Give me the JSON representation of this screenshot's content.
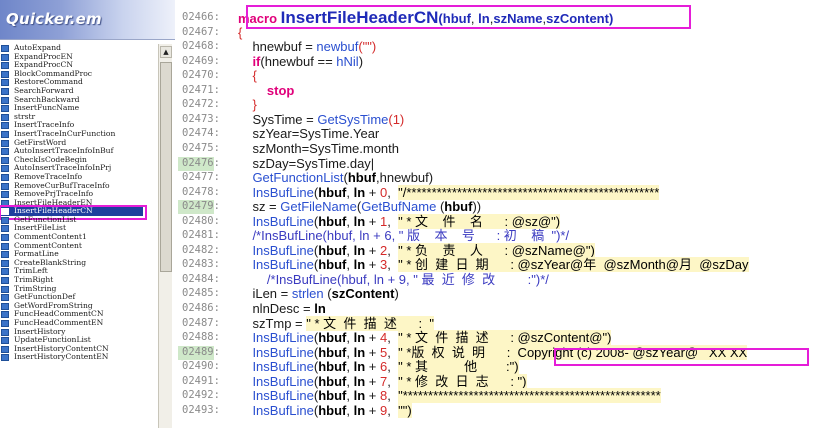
{
  "panel": {
    "title": "Quicker.em",
    "functions": [
      "AutoExpand",
      "ExpandProcEN",
      "ExpandProcCN",
      "BlockCommandProc",
      "RestoreCommand",
      "SearchForward",
      "SearchBackward",
      "InsertFuncName",
      "strstr",
      "InsertTraceInfo",
      "InsertTraceInCurFunction",
      "GetFirstWord",
      "AutoInsertTraceInfoInBuf",
      "CheckIsCodeBegin",
      "AutoInsertTraceInfoInPrj",
      "RemoveTraceInfo",
      "RemoveCurBufTraceInfo",
      "RemovePrjTraceInfo",
      "InsertFileHeaderEN",
      "InsertFileHeaderCN",
      "GetFunctionList",
      "InsertFileList",
      "CommentContent1",
      "CommentContent",
      "FormatLine",
      "CreateBlankString",
      "TrimLeft",
      "TrimRight",
      "TrimString",
      "GetFunctionDef",
      "GetWordFromString",
      "FuncHeadCommentCN",
      "FuncHeadCommentEN",
      "InsertHistory",
      "UpdateFunctionList",
      "InsertHistoryContentCN",
      "InsertHistoryContentEN"
    ],
    "selected_function": "InsertFileHeaderCN",
    "scroll_up_glyph": "▲"
  },
  "code": {
    "lines": [
      {
        "num": "02466:",
        "tokens": [
          [
            "kw",
            "macro "
          ],
          [
            "macro-name",
            "InsertFileHeaderCN"
          ],
          [
            "fnb",
            "("
          ],
          [
            "fnb",
            "hbuf"
          ],
          [
            "id",
            ", "
          ],
          [
            "fnb",
            "ln"
          ],
          [
            "id",
            ","
          ],
          [
            "fnb",
            "szName"
          ],
          [
            "id",
            ","
          ],
          [
            "fnb",
            "szContent"
          ],
          [
            "fnb",
            ")"
          ]
        ]
      },
      {
        "num": "02467:",
        "tokens": [
          [
            "num",
            "{"
          ]
        ]
      },
      {
        "num": "02468:",
        "tokens": [
          [
            "id",
            "    hnewbuf = "
          ],
          [
            "fn",
            "newbuf"
          ],
          [
            "num",
            "(\"\")"
          ]
        ]
      },
      {
        "num": "02469:",
        "tokens": [
          [
            "kw",
            "    if"
          ],
          [
            "id",
            "(hnewbuf == "
          ],
          [
            "fn",
            "hNil"
          ],
          [
            "id",
            ")"
          ]
        ]
      },
      {
        "num": "02470:",
        "tokens": [
          [
            "num",
            "    {"
          ]
        ]
      },
      {
        "num": "02471:",
        "tokens": [
          [
            "kw",
            "        stop"
          ]
        ]
      },
      {
        "num": "02472:",
        "tokens": [
          [
            "num",
            "    }"
          ]
        ]
      },
      {
        "num": "02473:",
        "tokens": [
          [
            "id",
            "    SysTime = "
          ],
          [
            "fn",
            "GetSysTime"
          ],
          [
            "num",
            "(1)"
          ]
        ]
      },
      {
        "num": "02474:",
        "tokens": [
          [
            "id",
            "    szYear=SysTime.Year"
          ]
        ]
      },
      {
        "num": "02475:",
        "tokens": [
          [
            "id",
            "    szMonth=SysTime.month"
          ]
        ]
      },
      {
        "num": "02476:",
        "tokens": [
          [
            "id",
            "    szDay=SysTime.day|"
          ]
        ]
      },
      {
        "num": "02477:",
        "tokens": [
          [
            "fn",
            "    GetFunctionList"
          ],
          [
            "id",
            "("
          ],
          [
            "bold",
            "hbuf"
          ],
          [
            "id",
            ",hnewbuf)"
          ]
        ]
      },
      {
        "num": "02478:",
        "tokens": [
          [
            "fn",
            "    InsBufLine"
          ],
          [
            "id",
            "("
          ],
          [
            "bold",
            "hbuf"
          ],
          [
            "id",
            ", "
          ],
          [
            "bold",
            "ln"
          ],
          [
            "id",
            " + "
          ],
          [
            "num",
            "0"
          ],
          [
            "id",
            ",  "
          ],
          [
            "hl",
            "\"/**************************************************"
          ]
        ]
      },
      {
        "num": "02479:",
        "tokens": [
          [
            "id",
            "    sz = "
          ],
          [
            "fn",
            "GetFileName"
          ],
          [
            "id",
            "("
          ],
          [
            "fn",
            "GetBufName"
          ],
          [
            "id",
            " ("
          ],
          [
            "bold",
            "hbuf"
          ],
          [
            "id",
            "))"
          ]
        ]
      },
      {
        "num": "02480:",
        "tokens": [
          [
            "fn",
            "    InsBufLine"
          ],
          [
            "id",
            "("
          ],
          [
            "bold",
            "hbuf"
          ],
          [
            "id",
            ", "
          ],
          [
            "bold",
            "ln"
          ],
          [
            "id",
            " + "
          ],
          [
            "num",
            "1"
          ],
          [
            "id",
            ",  "
          ],
          [
            "hl",
            "\" * 文    件    名      : @sz@\")"
          ]
        ]
      },
      {
        "num": "02481:",
        "tokens": [
          [
            "str",
            "    /*InsBufLine(hbuf, ln + 6, \" 版    本    号      : 初    稿  \")*/"
          ]
        ]
      },
      {
        "num": "02482:",
        "tokens": [
          [
            "fn",
            "    InsBufLine"
          ],
          [
            "id",
            "("
          ],
          [
            "bold",
            "hbuf"
          ],
          [
            "id",
            ", "
          ],
          [
            "bold",
            "ln"
          ],
          [
            "id",
            " + "
          ],
          [
            "num",
            "2"
          ],
          [
            "id",
            ",  "
          ],
          [
            "hl",
            "\" * 负    责    人      : @szName@\")"
          ]
        ]
      },
      {
        "num": "02483:",
        "tokens": [
          [
            "fn",
            "    InsBufLine"
          ],
          [
            "id",
            "("
          ],
          [
            "bold",
            "hbuf"
          ],
          [
            "id",
            ", "
          ],
          [
            "bold",
            "ln"
          ],
          [
            "id",
            " + "
          ],
          [
            "num",
            "3"
          ],
          [
            "id",
            ",  "
          ],
          [
            "hl",
            "\" * 创  建  日  期      : @szYear@年  @szMonth@月  @szDay"
          ]
        ]
      },
      {
        "num": "02484:",
        "tokens": [
          [
            "str",
            "        /*InsBufLine(hbuf, ln + 9, \" 最  近  修  改         :\")*/"
          ]
        ]
      },
      {
        "num": "02485:",
        "tokens": [
          [
            "id",
            "    iLen = "
          ],
          [
            "fn",
            "strlen"
          ],
          [
            "id",
            " ("
          ],
          [
            "bold",
            "szContent"
          ],
          [
            "id",
            ")"
          ]
        ]
      },
      {
        "num": "02486:",
        "tokens": [
          [
            "id",
            "    nlnDesc = "
          ],
          [
            "bold",
            "ln"
          ]
        ]
      },
      {
        "num": "02487:",
        "tokens": [
          [
            "id",
            "    szTmp = "
          ],
          [
            "hl",
            "\" * 文  件  描  述      :  \""
          ]
        ]
      },
      {
        "num": "02488:",
        "tokens": [
          [
            "fn",
            "    InsBufLine"
          ],
          [
            "id",
            "("
          ],
          [
            "bold",
            "hbuf"
          ],
          [
            "id",
            ", "
          ],
          [
            "bold",
            "ln"
          ],
          [
            "id",
            " + "
          ],
          [
            "num",
            "4"
          ],
          [
            "id",
            ",  "
          ],
          [
            "hl",
            "\" * 文  件  描  述      : @szContent@\")"
          ]
        ]
      },
      {
        "num": "02489:",
        "tokens": [
          [
            "fn",
            "    InsBufLine"
          ],
          [
            "id",
            "("
          ],
          [
            "bold",
            "hbuf"
          ],
          [
            "id",
            ", "
          ],
          [
            "bold",
            "ln"
          ],
          [
            "id",
            " + "
          ],
          [
            "num",
            "5"
          ],
          [
            "id",
            ",  "
          ],
          [
            "hl",
            "\" *版  权  说  明      :  Copyright (c) 2008- @szYear@   XX XX"
          ]
        ]
      },
      {
        "num": "02490:",
        "tokens": [
          [
            "fn",
            "    InsBufLine"
          ],
          [
            "id",
            "("
          ],
          [
            "bold",
            "hbuf"
          ],
          [
            "id",
            ", "
          ],
          [
            "bold",
            "ln"
          ],
          [
            "id",
            " + "
          ],
          [
            "num",
            "6"
          ],
          [
            "id",
            ",  "
          ],
          [
            "hl",
            "\" * 其          他        :\")"
          ]
        ]
      },
      {
        "num": "02491:",
        "tokens": [
          [
            "fn",
            "    InsBufLine"
          ],
          [
            "id",
            "("
          ],
          [
            "bold",
            "hbuf"
          ],
          [
            "id",
            ", "
          ],
          [
            "bold",
            "ln"
          ],
          [
            "id",
            " + "
          ],
          [
            "num",
            "7"
          ],
          [
            "id",
            ",  "
          ],
          [
            "hl",
            "\" * 修  改  日  志      : \")"
          ]
        ]
      },
      {
        "num": "02492:",
        "tokens": [
          [
            "fn",
            "    InsBufLine"
          ],
          [
            "id",
            "("
          ],
          [
            "bold",
            "hbuf"
          ],
          [
            "id",
            ", "
          ],
          [
            "bold",
            "ln"
          ],
          [
            "id",
            " + "
          ],
          [
            "num",
            "8"
          ],
          [
            "id",
            ",  "
          ],
          [
            "hl",
            "\"***************************************************"
          ]
        ]
      },
      {
        "num": "02493:",
        "tokens": [
          [
            "fn",
            "    InsBufLine"
          ],
          [
            "id",
            "("
          ],
          [
            "bold",
            "hbuf"
          ],
          [
            "id",
            ", "
          ],
          [
            "bold",
            "ln"
          ],
          [
            "id",
            " + "
          ],
          [
            "num",
            "9"
          ],
          [
            "id",
            ",  "
          ],
          [
            "hl",
            "\"\")"
          ]
        ]
      }
    ],
    "gutter_marked_lines": [
      "02476:",
      "02479:",
      "02489:"
    ]
  },
  "colors": {
    "keyword": "#e0007a",
    "function": "#2a4fd0",
    "highlight_box": "#e51dd8",
    "selection": "#1e3f9e",
    "string_bg": "#fdf6c6"
  }
}
